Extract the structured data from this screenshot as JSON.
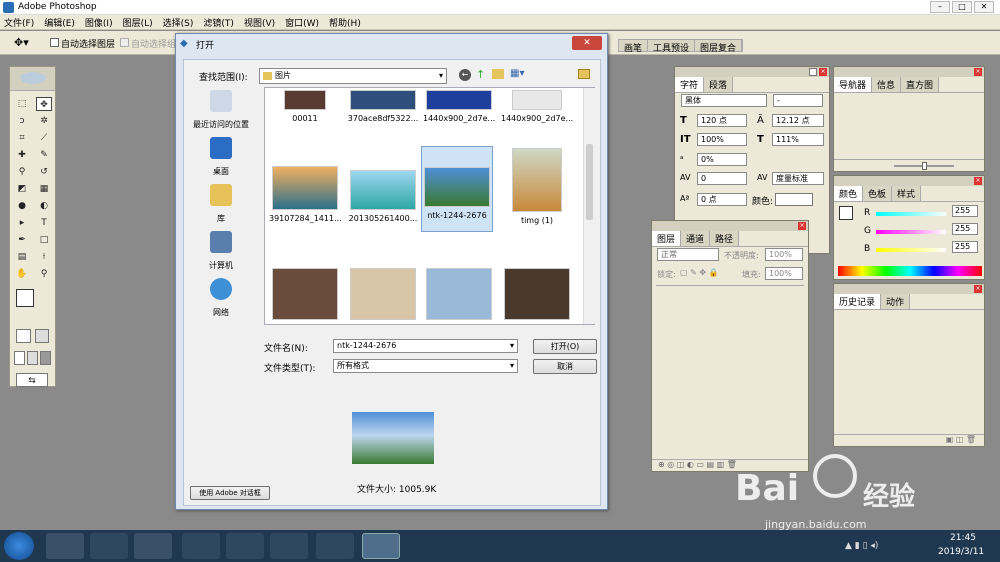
{
  "app": {
    "title": "Adobe Photoshop"
  },
  "menu": [
    "文件(F)",
    "编辑(E)",
    "图像(I)",
    "图层(L)",
    "选择(S)",
    "滤镜(T)",
    "视图(V)",
    "窗口(W)",
    "帮助(H)"
  ],
  "options": {
    "auto_select_layer": "自动选择图层",
    "auto_select_group": "自动选择组"
  },
  "palette_well": {
    "tabs": [
      "画笔",
      "工具预设",
      "图层复合"
    ]
  },
  "dialog": {
    "title": "打开",
    "look_in_label": "查找范围(I):",
    "look_in_value": "图片",
    "places": [
      "最近访问的位置",
      "桌面",
      "库",
      "计算机",
      "网络"
    ],
    "thumbs_row1": [
      "00011",
      "370ace8df5322...",
      "1440x900_2d7e...",
      "1440x900_2d7e..."
    ],
    "thumbs_row2": [
      "39107284_1411...",
      "201305261400...",
      "ntk-1244-2676",
      "timg (1)"
    ],
    "filename_label": "文件名(N):",
    "filename_value": "ntk-1244-2676",
    "filetype_label": "文件类型(T):",
    "filetype_value": "所有格式",
    "open_button": "打开(O)",
    "cancel_button": "取消",
    "filesize": "文件大小: 1005.9K",
    "adobe_dialog_button": "使用 Adobe 对话框"
  },
  "char_panel": {
    "tabs": [
      "字符",
      "段落"
    ],
    "font": "黑体",
    "font_style": "-",
    "size": "120 点",
    "leading": "12.12 点",
    "vscale": "100%",
    "hscale": "111%",
    "tracking_pct": "0%",
    "kerning": "0",
    "tracking": "度量标准",
    "baseline": "0 点",
    "color_label": "颜色:"
  },
  "layers_panel": {
    "tabs": [
      "图层",
      "通道",
      "路径"
    ],
    "mode": "正常",
    "opacity_label": "不透明度:",
    "opacity": "100%",
    "lock_label": "锁定:",
    "fill_label": "填充:",
    "fill": "100%"
  },
  "nav_panel": {
    "tabs": [
      "导航器",
      "信息",
      "直方图"
    ]
  },
  "color_panel": {
    "tabs": [
      "颜色",
      "色板",
      "样式"
    ],
    "channels": [
      {
        "name": "R",
        "value": "255"
      },
      {
        "name": "G",
        "value": "255"
      },
      {
        "name": "B",
        "value": "255"
      }
    ]
  },
  "history_panel": {
    "tabs": [
      "历史记录",
      "动作"
    ]
  },
  "taskbar": {
    "time": "21:45",
    "date": "2019/3/11"
  },
  "watermark": {
    "brand": "Bai",
    "brand2": "经验",
    "url": "jingyan.baidu.com"
  }
}
